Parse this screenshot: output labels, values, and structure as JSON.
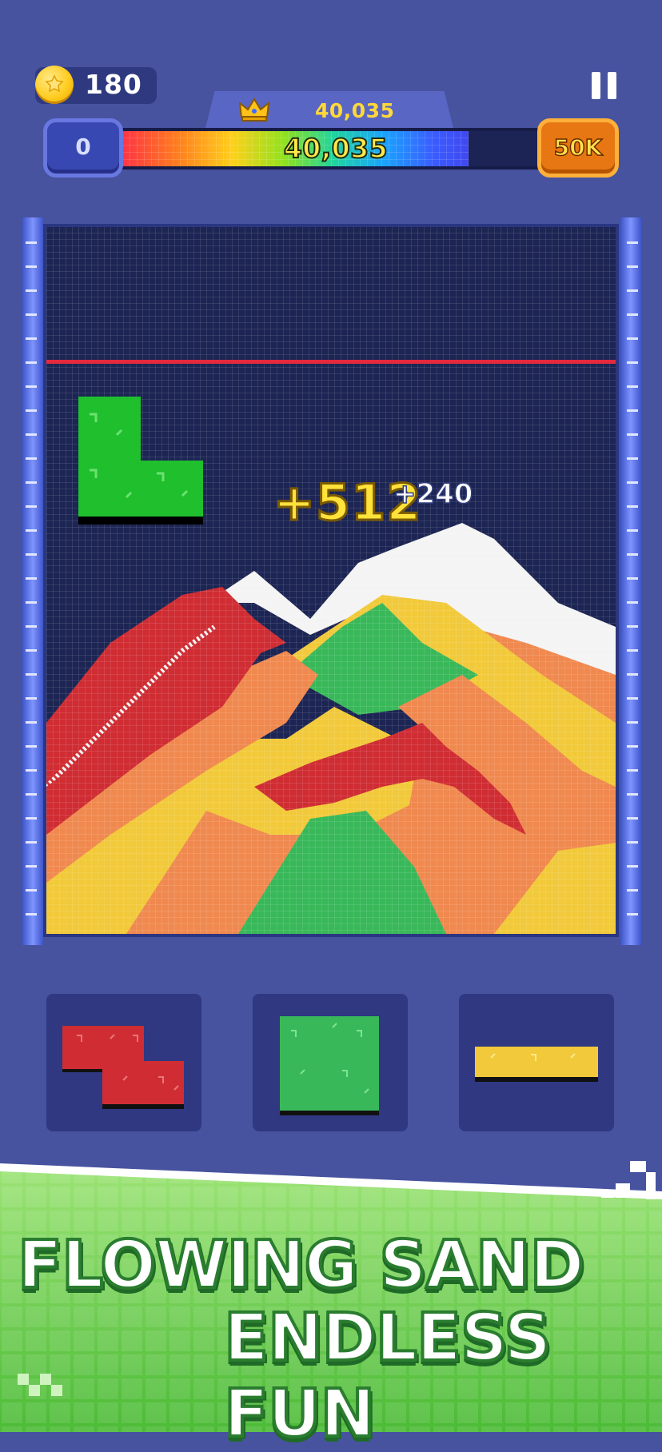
{
  "hud": {
    "coins": "180",
    "best_score": "40,035",
    "current_score": "40,035",
    "level_start": "0",
    "level_target": "50K",
    "progress_fraction": 0.8
  },
  "popups": {
    "big": "+512",
    "small": "+240"
  },
  "banner": {
    "line1": "FLOWING SAND",
    "line2": "ENDLESS FUN"
  },
  "colors": {
    "red": "#cf2d33",
    "orange": "#f0894f",
    "yellow": "#f1c93a",
    "green": "#39b85a",
    "white": "#f4f4f4",
    "board_bg": "#1c2553",
    "piece_green": "#1fbf2e"
  },
  "tray": {
    "pieces": [
      "red-z-piece",
      "green-square-piece",
      "yellow-bar-piece"
    ]
  }
}
